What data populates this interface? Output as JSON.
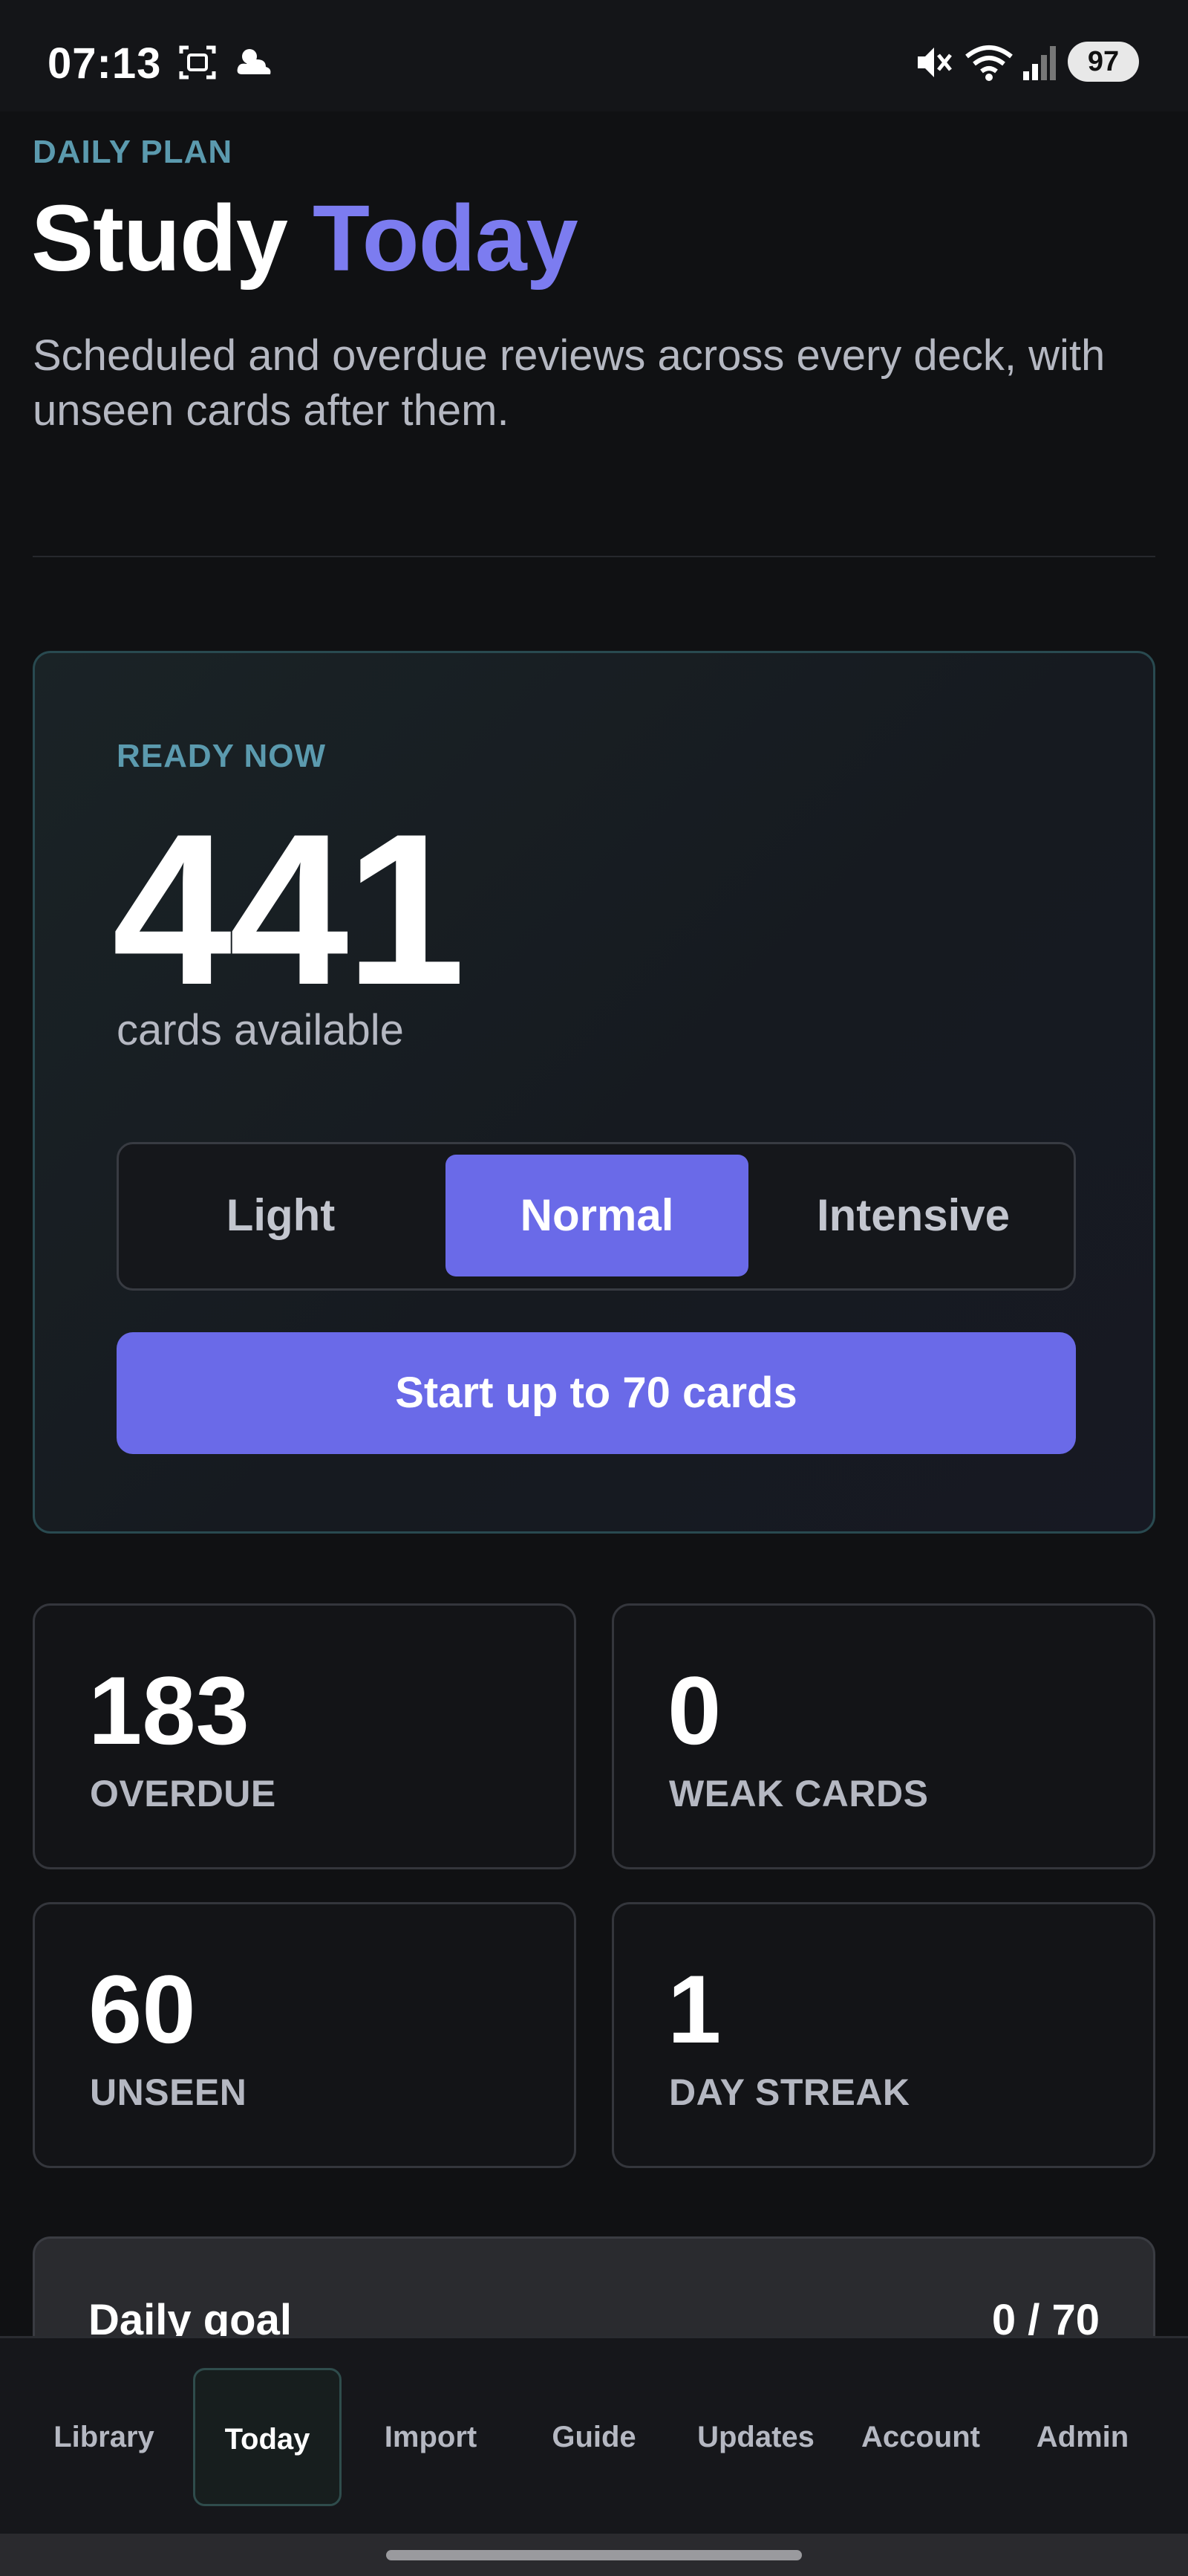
{
  "status_bar": {
    "time": "07:13",
    "battery": "97",
    "icons": [
      "screenshot-icon",
      "weather-icon",
      "mute-icon",
      "wifi-icon",
      "signal-icon"
    ]
  },
  "header": {
    "eyebrow": "DAILY PLAN",
    "title_main": "Study",
    "title_accent": "Today",
    "subtitle": "Scheduled and overdue reviews across every deck, with unseen cards after them."
  },
  "ready": {
    "label": "READY NOW",
    "count": "441",
    "caption": "cards available",
    "modes": [
      "Light",
      "Normal",
      "Intensive"
    ],
    "selected_mode": "Normal",
    "start_label": "Start up to 70 cards"
  },
  "stats": [
    {
      "value": "183",
      "label": "OVERDUE"
    },
    {
      "value": "0",
      "label": "WEAK CARDS"
    },
    {
      "value": "60",
      "label": "UNSEEN"
    },
    {
      "value": "1",
      "label": "DAY STREAK"
    }
  ],
  "goal": {
    "title": "Daily goal",
    "value": "0 / 70"
  },
  "nav": {
    "items": [
      "Library",
      "Today",
      "Import",
      "Guide",
      "Updates",
      "Account",
      "Admin"
    ],
    "active": "Today"
  },
  "colors": {
    "accent": "#6a6ae8",
    "title_accent": "#7c7cf0",
    "eyebrow": "#5b9aae",
    "background": "#101113"
  }
}
